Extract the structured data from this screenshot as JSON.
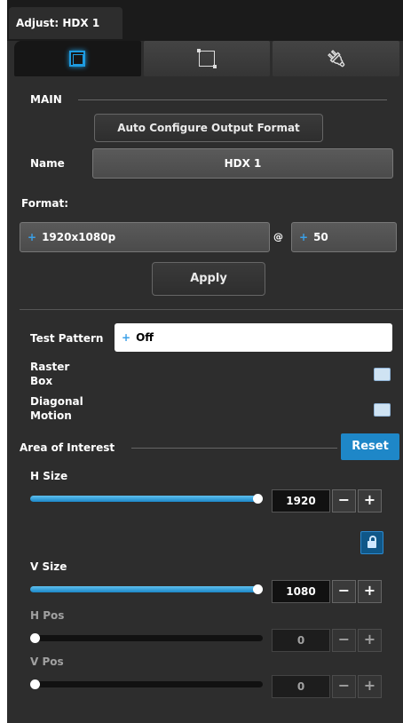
{
  "window": {
    "tab_title": "Adjust: HDX 1"
  },
  "tabs": [
    {
      "name": "output-view-tab",
      "icon": "display-square-icon"
    },
    {
      "name": "crop-tab",
      "icon": "crop-icon"
    },
    {
      "name": "connection-tab",
      "icon": "plug-icon"
    }
  ],
  "main": {
    "section_label": "MAIN",
    "auto_configure_label": "Auto Configure Output Format",
    "name_label": "Name",
    "name_value": "HDX 1",
    "format_label": "Format:",
    "resolution_value": "1920x1080p",
    "at_symbol": "@",
    "rate_value": "50",
    "apply_label": "Apply"
  },
  "test": {
    "test_pattern_label": "Test Pattern",
    "test_pattern_value": "Off",
    "raster_box_label_1": "Raster",
    "raster_box_label_2": "Box",
    "diagonal_motion_label_1": "Diagonal",
    "diagonal_motion_label_2": "Motion"
  },
  "aoi": {
    "title": "Area of Interest",
    "reset_label": "Reset",
    "h_size_label": "H Size",
    "h_size_value": "1920",
    "h_size_fraction": 1.0,
    "v_size_label": "V Size",
    "v_size_value": "1080",
    "v_size_fraction": 1.0,
    "h_pos_label": "H Pos",
    "h_pos_value": "0",
    "h_pos_fraction": 0.0,
    "v_pos_label": "V Pos",
    "v_pos_value": "0",
    "v_pos_fraction": 0.0,
    "minus": "−",
    "plus": "+"
  },
  "colors": {
    "accent": "#1e9be0",
    "panel_bg": "#2d2d2d",
    "reset_bg": "#1e87c8"
  }
}
